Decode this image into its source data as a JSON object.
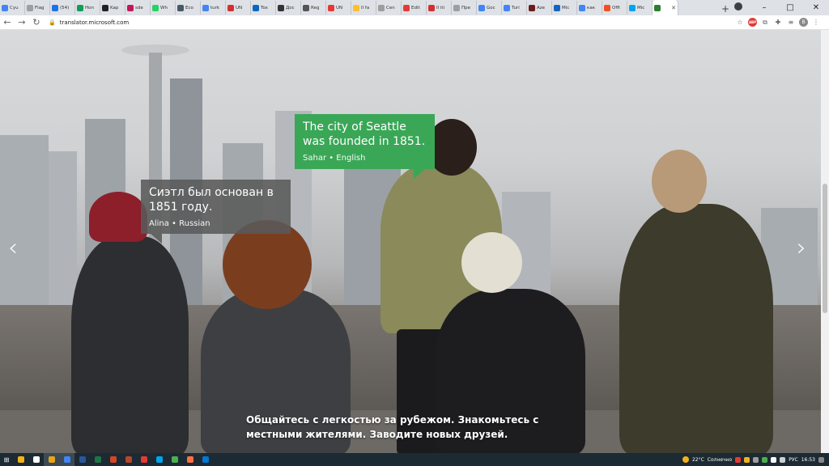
{
  "browser": {
    "tabs": [
      {
        "label": "Cyu",
        "color": "#4285f4"
      },
      {
        "label": "Flag",
        "color": "#9aa0a6"
      },
      {
        "label": "(54)",
        "color": "#1a73e8"
      },
      {
        "label": "Hon",
        "color": "#0f9d58"
      },
      {
        "label": "Kap",
        "color": "#202124"
      },
      {
        "label": "sde",
        "color": "#c2185b"
      },
      {
        "label": "Wh",
        "color": "#25d366"
      },
      {
        "label": "Eco",
        "color": "#455a64"
      },
      {
        "label": "turk",
        "color": "#4285f4"
      },
      {
        "label": "UN",
        "color": "#d32f2f"
      },
      {
        "label": "Tox",
        "color": "#0a66c2"
      },
      {
        "label": "Дос",
        "color": "#333333"
      },
      {
        "label": "Reg",
        "color": "#555555"
      },
      {
        "label": "UN",
        "color": "#e53935"
      },
      {
        "label": "Il fa",
        "color": "#fbc02d"
      },
      {
        "label": "Cen",
        "color": "#9e9e9e"
      },
      {
        "label": "Edit",
        "color": "#e53935"
      },
      {
        "label": "Il iti",
        "color": "#d32f2f"
      },
      {
        "label": "Пре",
        "color": "#9aa0a6"
      },
      {
        "label": "Goc",
        "color": "#4285f4"
      },
      {
        "label": "Turi",
        "color": "#4285f4"
      },
      {
        "label": "Aze",
        "color": "#6d1b1b"
      },
      {
        "label": "Mic",
        "color": "#1565c0"
      },
      {
        "label": "как",
        "color": "#4285f4"
      },
      {
        "label": "Offi",
        "color": "#f25022"
      },
      {
        "label": "Mic",
        "color": "#00a4ef"
      },
      {
        "label": "",
        "color": "#2e7d32",
        "active": true
      }
    ],
    "new_tab_symbol": "+",
    "url": "translator.microsoft.com"
  },
  "hero": {
    "bubble_en": {
      "quote": "The city of Seattle was founded in 1851.",
      "speaker": "Sahar • English"
    },
    "bubble_ru": {
      "quote": "Сиэтл был основан в 1851 году.",
      "speaker": "Alina • Russian"
    },
    "tagline": "Общайтесь с легкостью за рубежом. Знакомьтесь с местными жителями. Заводите новых друзей.",
    "prev_arrow": "‹",
    "next_arrow": "›"
  },
  "taskbar": {
    "apps": [
      {
        "color": "#f2b31a"
      },
      {
        "color": "#ffffff"
      },
      {
        "color": "#e8a317",
        "active": true
      },
      {
        "color": "#4285f4",
        "active": true
      },
      {
        "color": "#2b579a"
      },
      {
        "color": "#217346"
      },
      {
        "color": "#d24726"
      },
      {
        "color": "#b7472a"
      },
      {
        "color": "#e53935"
      },
      {
        "color": "#00a4ef"
      },
      {
        "color": "#4caf50"
      },
      {
        "color": "#ff7043"
      },
      {
        "color": "#0078d4"
      }
    ],
    "weather_temp": "22°C",
    "weather_text": "Солнечно",
    "lang": "РУС",
    "time": "16:53"
  },
  "colors": {
    "accent_green": "#3aa757",
    "bubble_gray": "#5a5a5a"
  }
}
